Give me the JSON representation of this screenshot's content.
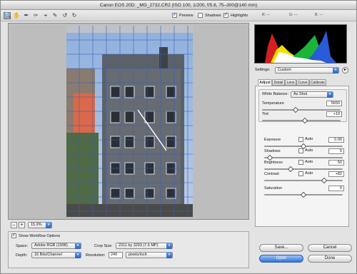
{
  "window": {
    "title": "Canon EOS 20D:  _MG_2732.CR2  (ISO 100, 1/200, f/5.6, 75–300@140 mm)"
  },
  "toolbar": {
    "tools": [
      "zoom-icon",
      "hand-icon",
      "eyedropper-icon",
      "color-sampler-icon",
      "crop-icon",
      "straighten-icon",
      "rotate-left-icon",
      "rotate-right-icon"
    ],
    "preview_label": "Preview",
    "preview_checked": true,
    "shadows_label": "Shadows",
    "shadows_checked": false,
    "highlights_label": "Highlights",
    "highlights_checked": true,
    "r_label": "R:",
    "r_value": "---",
    "g_label": "G:",
    "g_value": "---",
    "b_label": "B:",
    "b_value": "---"
  },
  "zoom": {
    "minus_label": "–",
    "plus_label": "+",
    "value": "15.9%"
  },
  "settings": {
    "label": "Settings:",
    "value": "Custom"
  },
  "tabs": [
    "Adjust",
    "Detail",
    "Lens",
    "Curve",
    "Calibrate"
  ],
  "white_balance": {
    "label": "White Balance:",
    "value": "As Shot"
  },
  "sliders": {
    "temperature": {
      "label": "Temperature",
      "value": "5650",
      "level": 0.42
    },
    "tint": {
      "label": "Tint",
      "value": "+10",
      "level": 0.55
    },
    "exposure": {
      "label": "Exposure",
      "auto_label": "Auto",
      "value": "0.00",
      "level": 0.5
    },
    "shadows": {
      "label": "Shadows",
      "auto_label": "Auto",
      "value": "5",
      "level": 0.05
    },
    "brightness": {
      "label": "Brightness",
      "auto_label": "Auto",
      "value": "50",
      "level": 0.33
    },
    "contrast": {
      "label": "Contrast",
      "auto_label": "Auto",
      "value": "+82",
      "level": 0.78
    },
    "saturation": {
      "label": "Saturation",
      "value": "0",
      "level": 0.5
    }
  },
  "workflow": {
    "show_label": "Show Workflow Options",
    "space_label": "Space:",
    "space_value": "Adobe RGB (1998)",
    "depth_label": "Depth:",
    "depth_value": "16 Bits/Channel",
    "crop_label": "Crop Size:",
    "crop_value": "2311 by 3293  (7.6 MP)",
    "resolution_label": "Resolution:",
    "resolution_value": "240",
    "resolution_unit": "pixels/inch"
  },
  "buttons": {
    "save": "Save...",
    "cancel": "Cancel",
    "open": "Open",
    "done": "Done"
  },
  "colors": {
    "accent": "#2f74d6",
    "histogram_bg": "#000000"
  }
}
